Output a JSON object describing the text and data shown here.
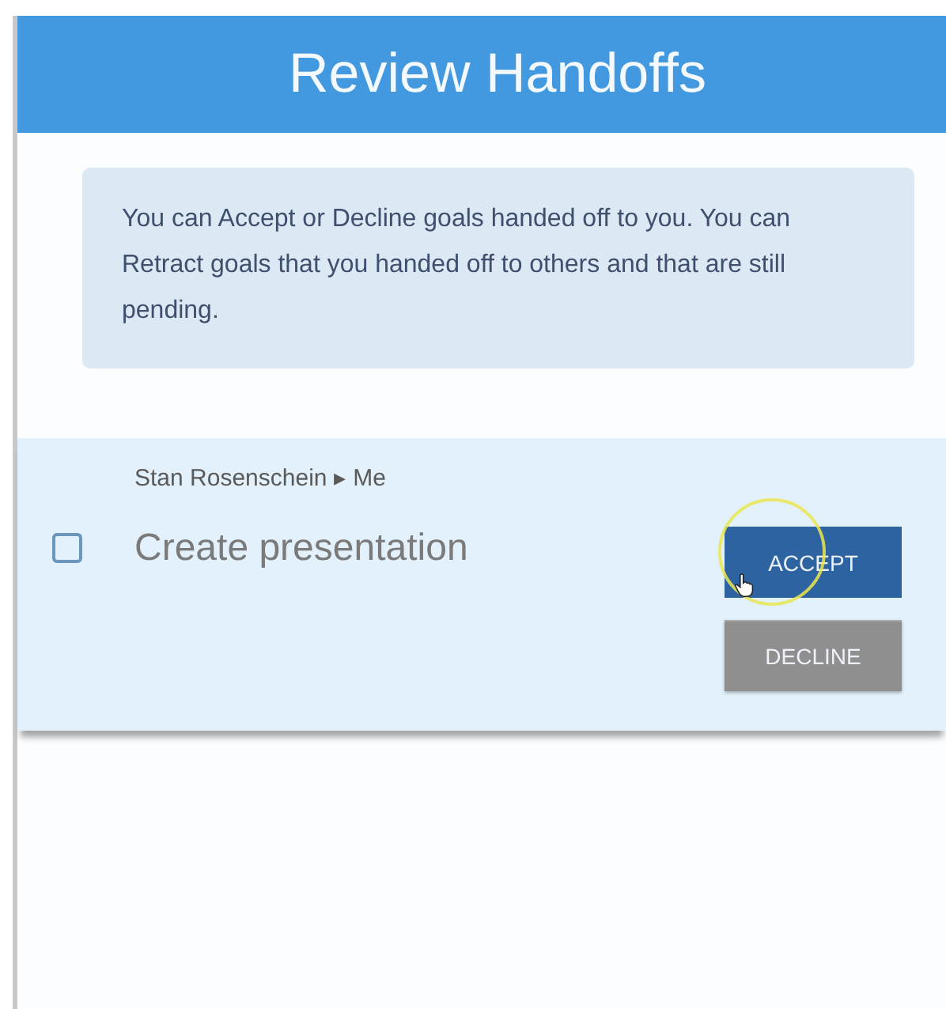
{
  "header": {
    "title": "Review Handoffs"
  },
  "info": {
    "text": "You can Accept or Decline goals handed off to you. You can Retract goals that you handed off to others and that are still pending."
  },
  "handoffs": [
    {
      "from": "Stan Rosenschein",
      "separator": "▸",
      "to": "Me",
      "title": "Create presentation",
      "checked": false,
      "actions": [
        {
          "label": "ACCEPT",
          "kind": "primary"
        },
        {
          "label": "DECLINE",
          "kind": "secondary"
        }
      ]
    }
  ]
}
